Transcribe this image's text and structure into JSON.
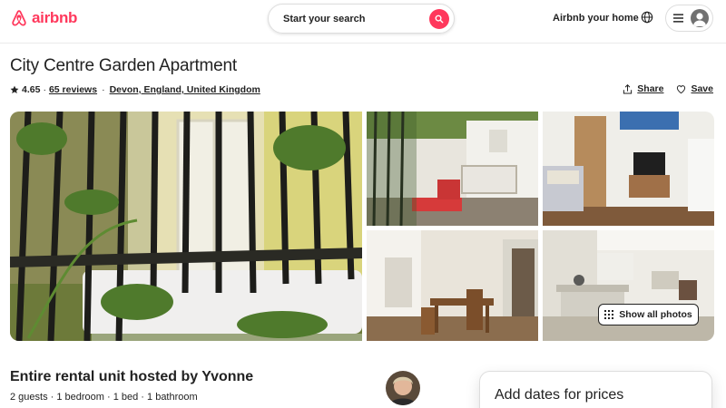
{
  "header": {
    "logo_text": "airbnb",
    "search_placeholder": "Start your search",
    "host_link": "Airbnb your home",
    "icons": [
      "airbnb-logo-icon",
      "search-icon",
      "globe-icon",
      "hamburger-menu-icon",
      "user-avatar-icon"
    ]
  },
  "listing": {
    "title": "City Centre Garden Apartment",
    "rating": "4.65",
    "rating_sep": "·",
    "reviews": "65 reviews",
    "dot": "·",
    "location": "Devon, England, United Kingdom",
    "share_label": "Share",
    "save_label": "Save"
  },
  "gallery": {
    "show_all_label": "Show all photos",
    "photos": [
      "Balcony with plants",
      "Patio with table",
      "Living room",
      "Dining area",
      "Kitchen"
    ]
  },
  "summary": {
    "heading": "Entire rental unit hosted by Yvonne",
    "details": "2 guests · 1 bedroom · 1 bed · 1 bathroom"
  },
  "booking": {
    "title": "Add dates for prices"
  },
  "colors": {
    "brand": "#ff385c",
    "text": "#222222",
    "border": "#dddddd"
  }
}
